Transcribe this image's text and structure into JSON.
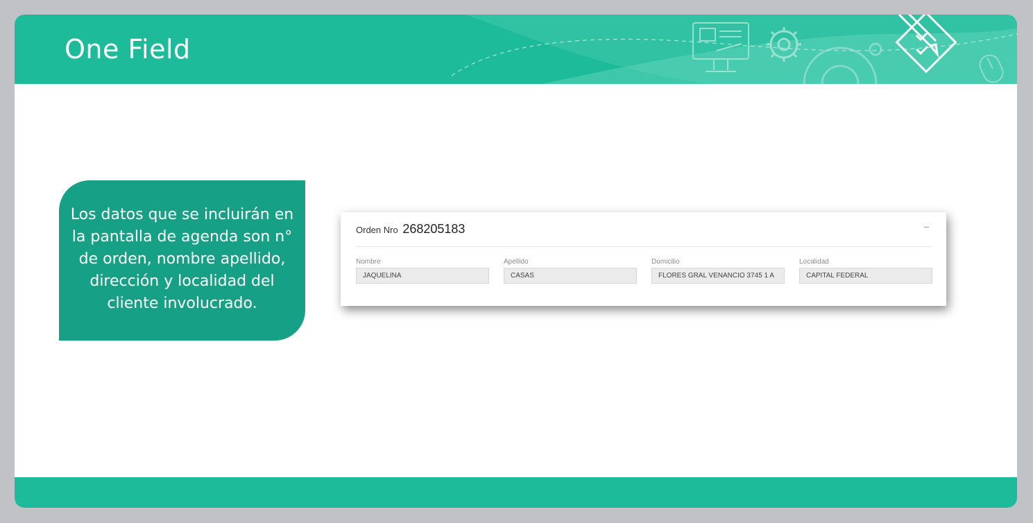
{
  "slide": {
    "title": "One Field",
    "callout_text": "Los datos que se incluirán en la pantalla de agenda son n° de orden, nombre apellido, dirección y localidad del cliente involucrado."
  },
  "order_panel": {
    "order_label": "Orden Nro",
    "order_number": "268205183",
    "collapse_icon": "minus-icon",
    "fields": [
      {
        "label": "Nombre",
        "value": "JAQUELINA"
      },
      {
        "label": "Apellido",
        "value": "CASAS"
      },
      {
        "label": "Domicilio",
        "value": "FLORES GRAL VENANCIO 3745 1 A"
      },
      {
        "label": "Localidad",
        "value": "CAPITAL FEDERAL"
      }
    ]
  },
  "header_icons": [
    "monitor-presentation-icon",
    "gear-icon",
    "checklist-pencil-icon",
    "mouse-icon"
  ],
  "colors": {
    "frame": "#c0c2c5",
    "accent": "#1dbb99",
    "callout": "#16a085",
    "panel_background": "#ffffff",
    "input_background": "#ebebeb"
  }
}
